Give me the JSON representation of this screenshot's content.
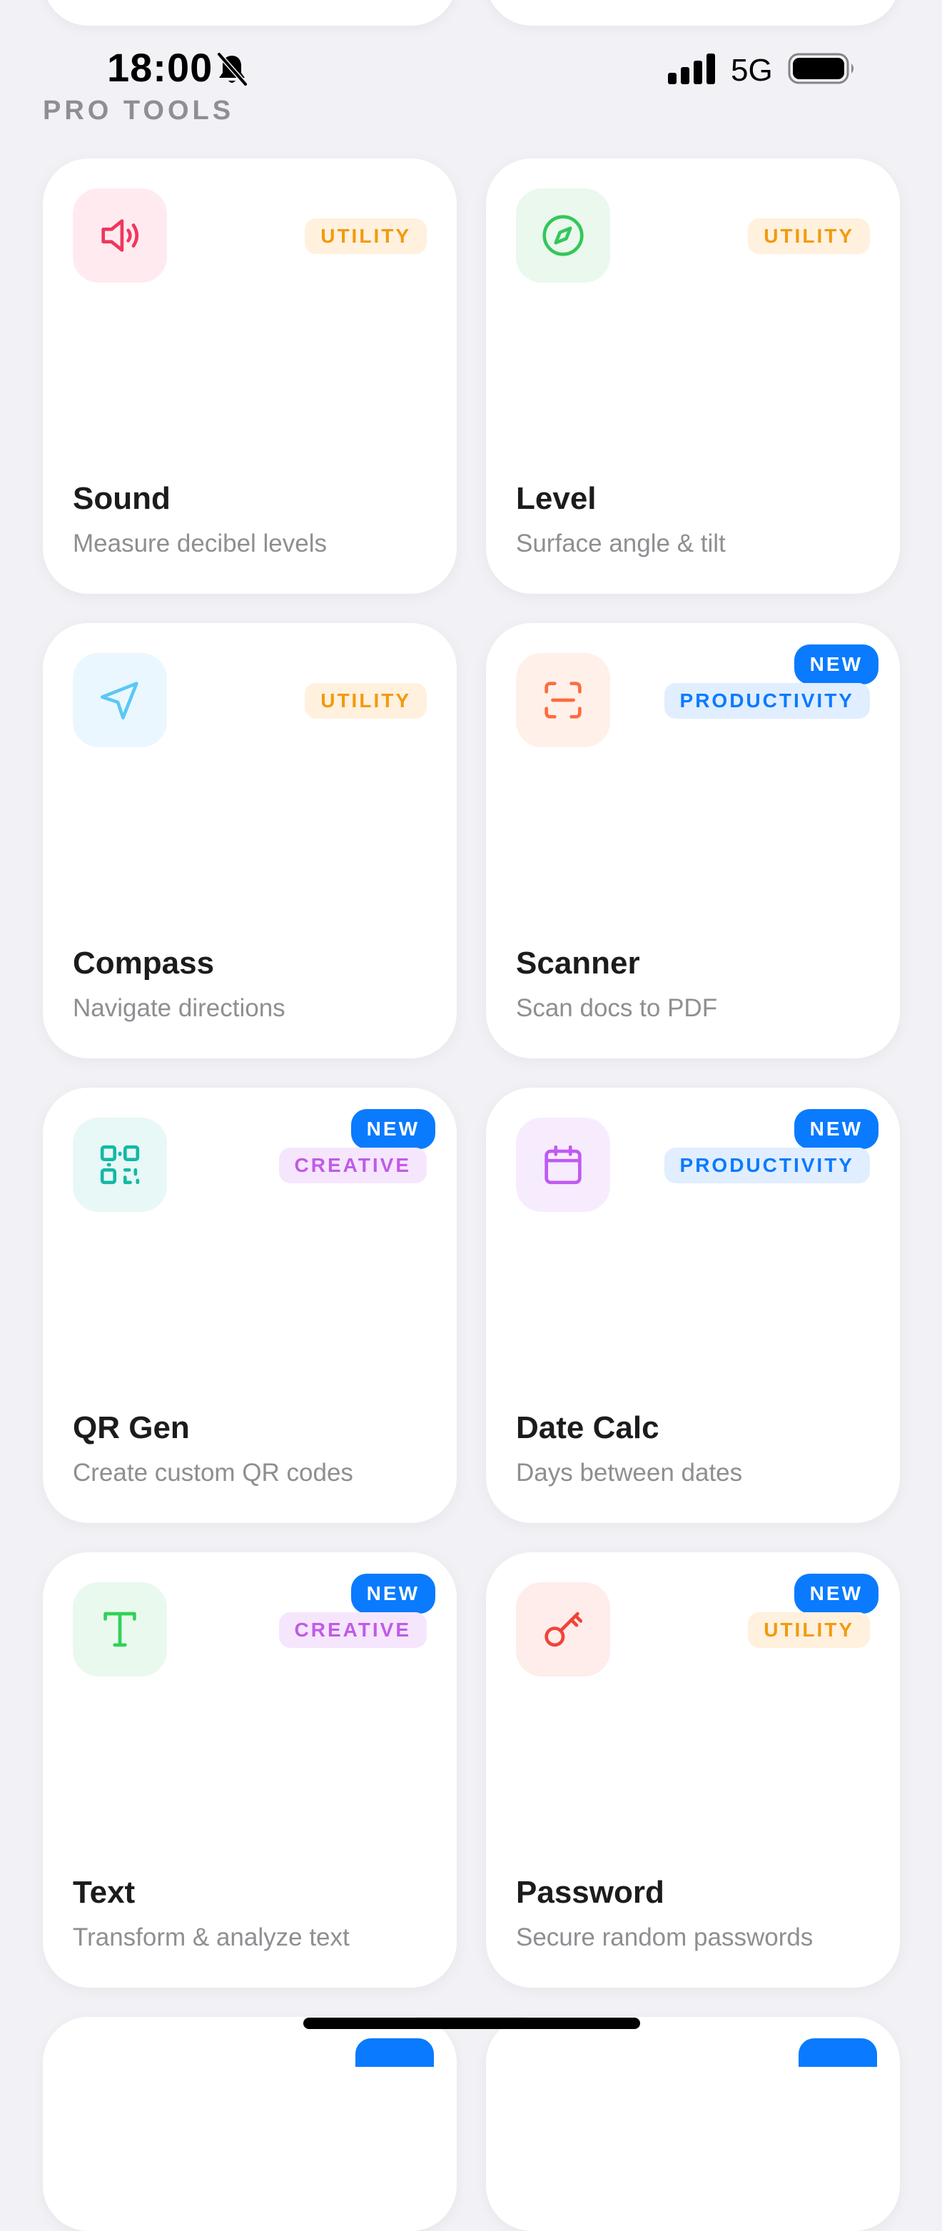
{
  "status_bar": {
    "time": "18:00",
    "network": "5G",
    "icons": [
      "bell-slash-icon",
      "signal-icon",
      "battery-icon"
    ]
  },
  "section": {
    "title": "PRO TOOLS"
  },
  "colors": {
    "new_badge_bg": "#0A7AFF",
    "utility_text": "#F29A0E",
    "utility_bg": "#FFF1DE",
    "productivity_text": "#0A7AFF",
    "productivity_bg": "#E0EEFF",
    "creative_text": "#C05BE6",
    "creative_bg": "#F6E6FD"
  },
  "cards": [
    {
      "title": "Sound",
      "subtitle": "Measure decibel levels",
      "tag": "UTILITY",
      "tag_kind": "utility",
      "new": false,
      "new_label": "",
      "icon": "speaker-icon",
      "icon_color": "#F0365E",
      "tile_bg": "#FFEBEF"
    },
    {
      "title": "Level",
      "subtitle": "Surface angle & tilt",
      "tag": "UTILITY",
      "tag_kind": "utility",
      "new": false,
      "new_label": "",
      "icon": "compass-icon",
      "icon_color": "#34C759",
      "tile_bg": "#EAF8EE"
    },
    {
      "title": "Compass",
      "subtitle": "Navigate directions",
      "tag": "UTILITY",
      "tag_kind": "utility",
      "new": false,
      "new_label": "",
      "icon": "navigation-arrow-icon",
      "icon_color": "#5AC8F5",
      "tile_bg": "#EBF7FE"
    },
    {
      "title": "Scanner",
      "subtitle": "Scan docs to PDF",
      "tag": "PRODUCTIVITY",
      "tag_kind": "productivity",
      "new": true,
      "new_label": "NEW",
      "icon": "scan-icon",
      "icon_color": "#FF6B3D",
      "tile_bg": "#FFF0EA"
    },
    {
      "title": "QR Gen",
      "subtitle": "Create custom QR codes",
      "tag": "CREATIVE",
      "tag_kind": "creative",
      "new": true,
      "new_label": "NEW",
      "icon": "qr-code-icon",
      "icon_color": "#14B8A6",
      "tile_bg": "#E7F8F6"
    },
    {
      "title": "Date Calc",
      "subtitle": "Days between dates",
      "tag": "PRODUCTIVITY",
      "tag_kind": "productivity",
      "new": true,
      "new_label": "NEW",
      "icon": "calendar-icon",
      "icon_color": "#BF5AF2",
      "tile_bg": "#F7ECFE"
    },
    {
      "title": "Text",
      "subtitle": "Transform & analyze text",
      "tag": "CREATIVE",
      "tag_kind": "creative",
      "new": true,
      "new_label": "NEW",
      "icon": "text-icon",
      "icon_color": "#30D158",
      "tile_bg": "#EAF9EE"
    },
    {
      "title": "Password",
      "subtitle": "Secure random passwords",
      "tag": "UTILITY",
      "tag_kind": "utility",
      "new": true,
      "new_label": "NEW",
      "icon": "key-icon",
      "icon_color": "#F04438",
      "tile_bg": "#FEEDEB"
    }
  ]
}
